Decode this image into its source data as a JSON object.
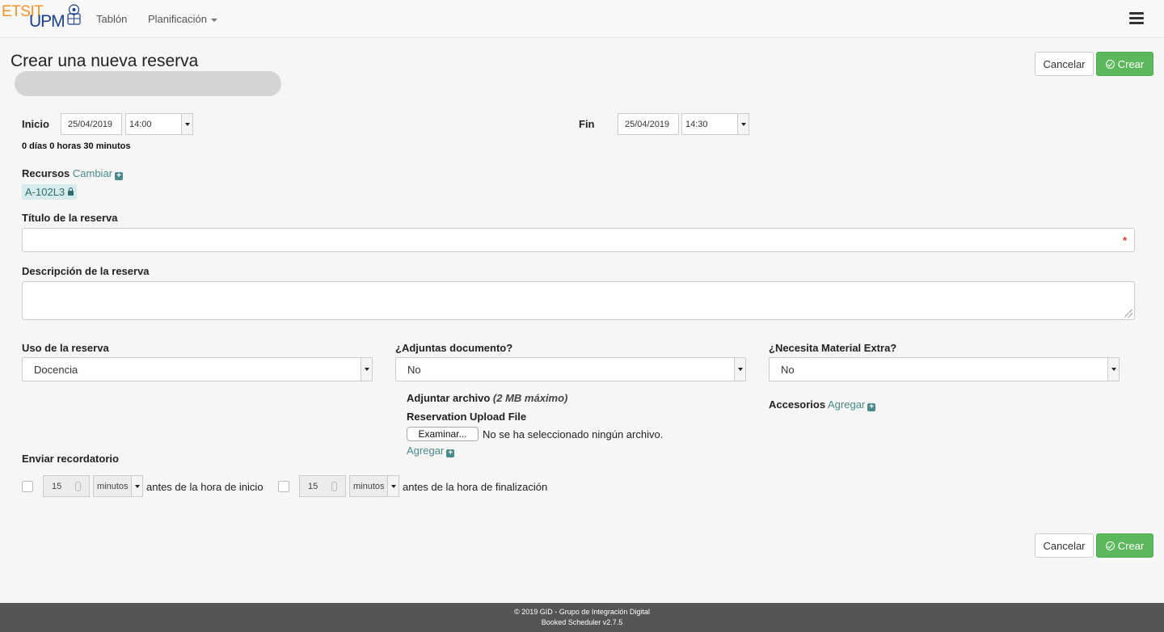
{
  "navbar": {
    "logo_etsit": "ETSIT",
    "logo_upm": "UPM",
    "links": [
      {
        "label": "Tablón"
      },
      {
        "label": "Planificación"
      }
    ]
  },
  "header": {
    "title": "Crear una nueva reserva",
    "cancel_label": "Cancelar",
    "create_label": "Crear"
  },
  "dates": {
    "start_label": "Inicio",
    "start_date": "25/04/2019",
    "start_time": "14:00",
    "end_label": "Fin",
    "end_date": "25/04/2019",
    "end_time": "14:30",
    "duration": "0 días 0 horas 30 minutos"
  },
  "resources": {
    "label": "Recursos",
    "change_link": "Cambiar",
    "items": [
      "A-102L3"
    ]
  },
  "title_field": {
    "label": "Título de la reserva",
    "value": "",
    "required_mark": "*"
  },
  "description_field": {
    "label": "Descripción de la reserva",
    "value": ""
  },
  "usage": {
    "label": "Uso de la reserva",
    "selected": "Docencia"
  },
  "attach": {
    "label": "¿Adjuntas documento?",
    "selected": "No",
    "file_label": "Adjuntar archivo",
    "file_note": "(2 MB máximo)",
    "upload_label": "Reservation Upload File",
    "browse_button": "Examinar...",
    "no_file_text": "No se ha seleccionado ningún archivo.",
    "add_link": "Agregar"
  },
  "extra": {
    "label": "¿Necesita Material Extra?",
    "selected": "No",
    "accessories_label": "Accesorios",
    "add_link": "Agregar"
  },
  "reminder": {
    "label": "Enviar recordatorio",
    "start": {
      "value": "15",
      "unit": "minutos",
      "text": "antes de la hora de inicio",
      "checked": false
    },
    "end": {
      "value": "15",
      "unit": "minutos",
      "text": "antes de la hora de finalización",
      "checked": false
    }
  },
  "footer": {
    "line1": "© 2019 GID - Grupo de Integración Digital",
    "line2": "Booked Scheduler v2.7.5"
  },
  "colors": {
    "success": "#5cb85c",
    "link": "#4a8a8a",
    "required": "#d9342b",
    "footer_bg": "#555555"
  }
}
